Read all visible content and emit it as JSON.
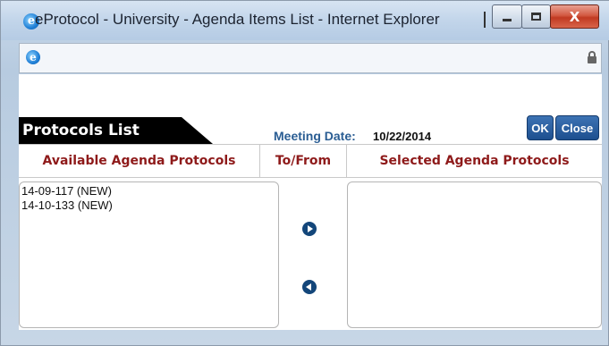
{
  "window": {
    "title": "eProtocol - University - Agenda Items List - Internet Explorer",
    "logo_glyph": "e",
    "close_glyph": "X",
    "accent_color": "#1d4f8f"
  },
  "panel": {
    "title": "Protocols List",
    "meeting_date_label": "Meeting Date:",
    "meeting_date_value": "10/22/2014",
    "ok_label": "OK",
    "close_label": "Close"
  },
  "columns": {
    "available": "Available Agenda Protocols",
    "to_from": "To/From",
    "selected": "Selected Agenda Protocols"
  },
  "available_items": [
    "14-09-117 (NEW)",
    "14-10-133 (NEW)"
  ],
  "selected_items": [],
  "icons": {
    "move_right": "arrow-right-circle-icon",
    "move_left": "arrow-left-circle-icon",
    "lock": "lock-icon"
  }
}
